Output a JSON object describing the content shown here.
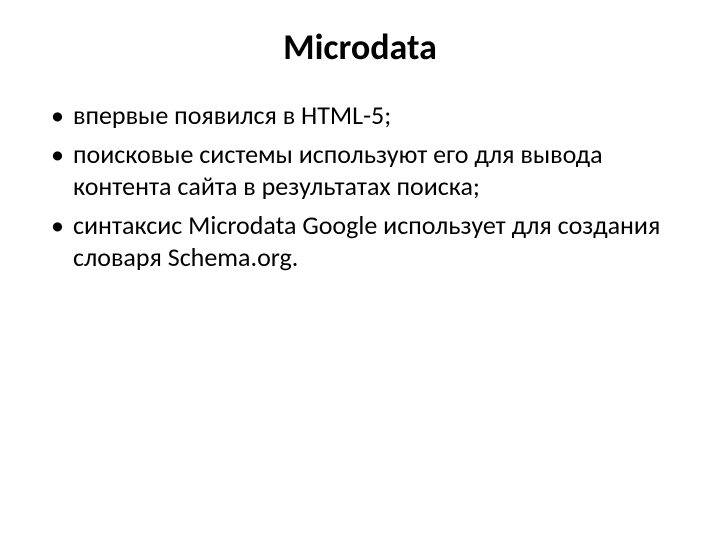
{
  "title": "Microdata",
  "bullets": [
    "впервые появился в HTML-5;",
    "поисковые системы используют его для вывода контента сайта в результатах поиска;",
    "синтаксис Microdata Google использует для создания словаря Schema.org."
  ]
}
